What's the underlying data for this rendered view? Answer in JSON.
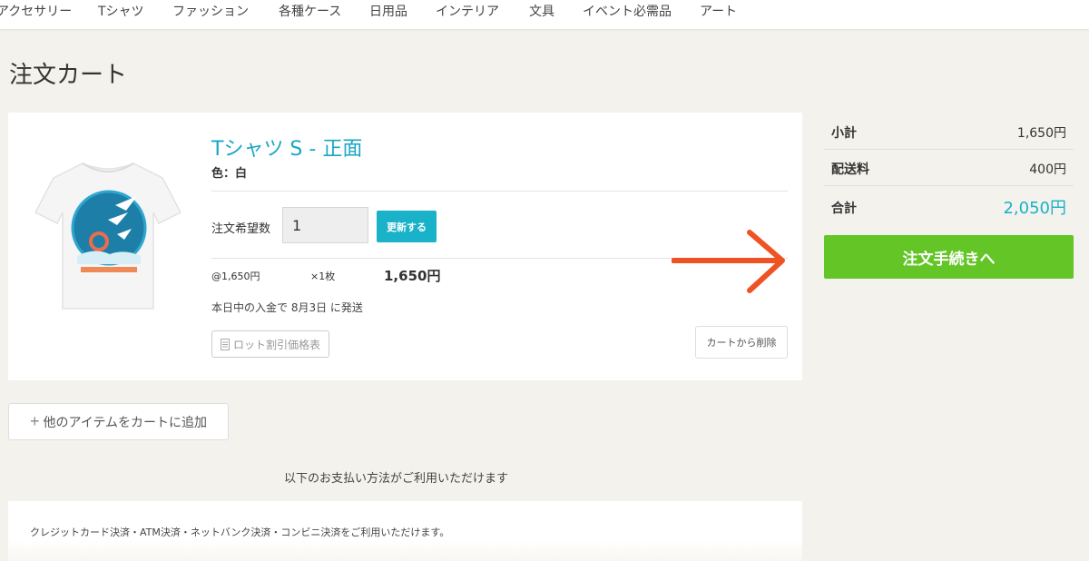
{
  "nav": {
    "items": [
      "アクセサリー",
      "Tシャツ",
      "ファッション",
      "各種ケース",
      "日用品",
      "インテリア",
      "文具",
      "イベント必需品",
      "アート"
    ]
  },
  "page": {
    "title": "注文カート"
  },
  "cart": {
    "item": {
      "title": "Tシャツ S - 正面",
      "variant": "色：白",
      "qty_label": "注文希望数",
      "qty_value": "1",
      "update_label": "更新する",
      "unit_price": "@1,650円",
      "unit_qty": "×1枚",
      "line_total": "1,650円",
      "shipping_note": "本日中の入金で 8月3日 に発送",
      "lot_price_label": "ロット割引価格表",
      "delete_label": "カートから削除"
    }
  },
  "summary": {
    "subtotal_label": "小計",
    "subtotal_value": "1,650円",
    "shipping_label": "配送料",
    "shipping_value": "400円",
    "total_label": "合計",
    "total_value": "2,050円",
    "checkout_label": "注文手続きへ"
  },
  "add_item": {
    "label": "他のアイテムをカートに追加"
  },
  "payment": {
    "heading": "以下のお支払い方法がご利用いただけます",
    "methods_text": "クレジットカード決済・ATM決済・ネットバンク決済・コンビニ決済をご利用いただけます。"
  },
  "colors": {
    "accent_teal": "#19b2c8",
    "link_teal": "#1aa7c4",
    "checkout_green": "#63c526",
    "arrow_orange": "#f05323",
    "page_bg": "#f4f2ec"
  },
  "icons": {
    "arrow": "right-arrow-icon",
    "document": "document-icon",
    "plus": "plus-icon"
  }
}
